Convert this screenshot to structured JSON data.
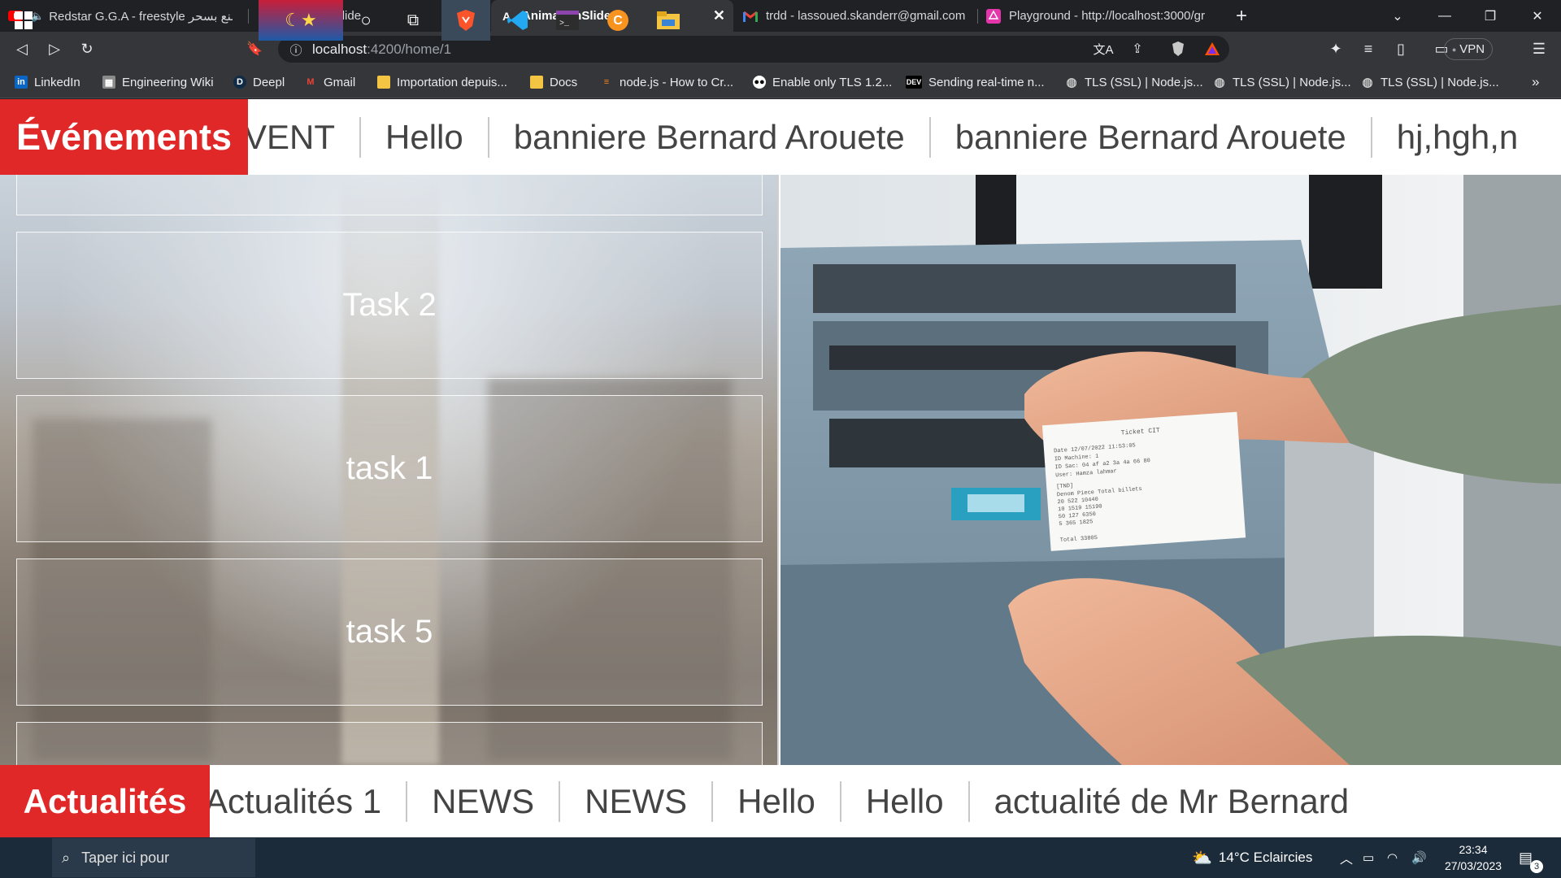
{
  "browser": {
    "tabs": [
      {
        "title": "Redstar G.G.A - freestyle صنع بسحر",
        "icon": "youtube-icon",
        "active": false
      },
      {
        "title": "AnimationSlide",
        "icon": "angular-icon",
        "active": false
      },
      {
        "title": "AnimationSlide",
        "icon": "angular-icon",
        "active": true
      },
      {
        "title": "trdd - lassoued.skanderr@gmail.com -",
        "icon": "gmail-icon",
        "active": false
      },
      {
        "title": "Playground - http://localhost:3000/gr",
        "icon": "graphql-icon",
        "active": false
      }
    ],
    "new_tab": "+",
    "url_host": "localhost",
    "url_path": ":4200/home/1",
    "vpn_label": "VPN",
    "bookmarks": [
      {
        "label": "LinkedIn",
        "icon": "linkedin-icon"
      },
      {
        "label": "Engineering Wiki",
        "icon": "wiki-icon"
      },
      {
        "label": "Deepl",
        "icon": "deepl-icon"
      },
      {
        "label": "Gmail",
        "icon": "gmail-icon"
      },
      {
        "label": "Importation depuis...",
        "icon": "folder-icon"
      },
      {
        "label": "Docs",
        "icon": "folder-icon"
      },
      {
        "label": "node.js - How to Cr...",
        "icon": "stackoverflow-icon"
      },
      {
        "label": "Enable only TLS 1.2...",
        "icon": "medium-icon"
      },
      {
        "label": "Sending real-time n...",
        "icon": "dev-icon"
      },
      {
        "label": "TLS (SSL) | Node.js...",
        "icon": "globe-icon"
      },
      {
        "label": "TLS (SSL) | Node.js...",
        "icon": "globe-icon"
      },
      {
        "label": "TLS (SSL) | Node.js...",
        "icon": "globe-icon"
      }
    ],
    "bookmarks_more": "»"
  },
  "events": {
    "label": "Événements",
    "items": [
      "VENT",
      "Hello",
      "banniere Bernard Arouete",
      "banniere Bernard Arouete",
      "hj,hgh,n"
    ]
  },
  "tasks": [
    "Task 2",
    "task 1",
    "task 5"
  ],
  "news": {
    "label": "Actualités",
    "items": [
      "Actualités 1",
      "NEWS",
      "NEWS",
      "Hello",
      "Hello",
      "actualité de Mr Bernard"
    ]
  },
  "receipt": {
    "title": "Ticket CIT",
    "lines": [
      "Date      12/07/2022 11:53:05",
      "ID Machine:  1",
      "ID Sac:  04 af a2 3a 4a 66 80",
      "User:  Hamza lahmar",
      "[TND]",
      "Denom    Piece    Total billets",
      "20       522      10440",
      "10       1519     15190",
      "50       127      6350",
      "5        365      1825",
      "Total              33805"
    ]
  },
  "taskbar": {
    "search_placeholder": "Taper ici pour",
    "weather": "14°C  Eclaircies",
    "time": "23:34",
    "date": "27/03/2023",
    "notif_count": "3"
  },
  "colors": {
    "accent_red": "#e02828",
    "taskbar": "#1c2b3a"
  }
}
